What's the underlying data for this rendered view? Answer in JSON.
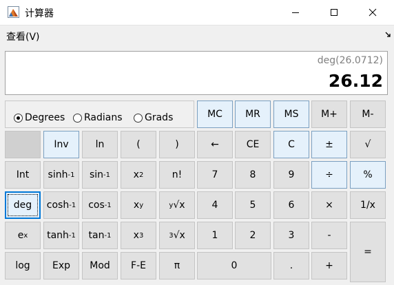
{
  "window": {
    "title": "计算器"
  },
  "menu": {
    "view": "查看(V)"
  },
  "display": {
    "expression": "deg(26.0712)",
    "value": "26.12"
  },
  "angle_mode": {
    "degrees": "Degrees",
    "radians": "Radians",
    "grads": "Grads",
    "selected": "Degrees"
  },
  "keys": {
    "mc": "MC",
    "mr": "MR",
    "ms": "MS",
    "mplus": "M+",
    "mminus": "M-",
    "inv": "Inv",
    "ln": "ln",
    "lparen": "(",
    "rparen": ")",
    "back": "←",
    "ce": "CE",
    "c": "C",
    "pm": "±",
    "sqrt": "√",
    "int": "Int",
    "sinh": "sinh",
    "sin": "sin",
    "sq_base": "x",
    "sq_exp": "2",
    "fact": "n!",
    "n7": "7",
    "n8": "8",
    "n9": "9",
    "div": "÷",
    "pct": "%",
    "deg": "deg",
    "cosh": "cosh",
    "cos": "cos",
    "xy_base": "x",
    "xy_exp": "y",
    "yroot_idx": "y",
    "yroot_x": "x",
    "n4": "4",
    "n5": "5",
    "n6": "6",
    "mul": "×",
    "recip": "1/x",
    "ex_base": "e",
    "ex_exp": "x",
    "tanh": "tanh",
    "tan": "tan",
    "cube_base": "x",
    "cube_exp": "3",
    "croot_idx": "3",
    "croot_x": "x",
    "n1": "1",
    "n2": "2",
    "n3": "3",
    "sub": "-",
    "eq": "=",
    "log": "log",
    "exp": "Exp",
    "mod": "Mod",
    "fe": "F-E",
    "pi": "π",
    "n0": "0",
    "dot": ".",
    "add": "+",
    "inv_exp": "-1"
  }
}
